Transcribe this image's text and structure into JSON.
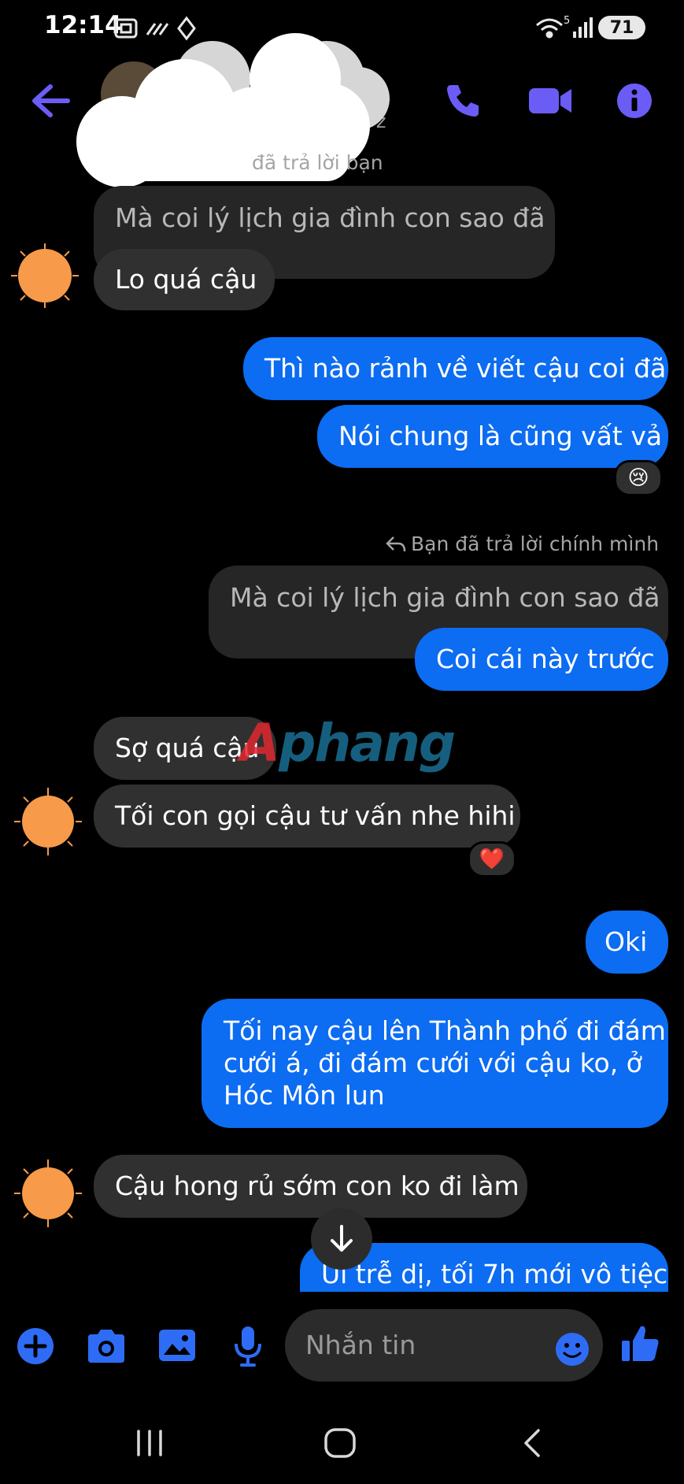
{
  "status_bar": {
    "time": "12:14",
    "wifi_superscript": "5",
    "battery": "71"
  },
  "header": {
    "subtitle_fragment": "n z",
    "icons": [
      "back-arrow-icon",
      "phone-icon",
      "video-call-icon",
      "info-icon"
    ]
  },
  "messages": {
    "reply_note_1": "đã trả lời bạn",
    "quoted_1": "Mà coi lý lịch gia đình con sao đã",
    "in_1": "Lo quá cậu",
    "out_1": "Thì nào rảnh về viết cậu coi đã",
    "out_2": "Nói chung là cũng vất vả",
    "reaction_1": "😢",
    "reply_note_2": "Bạn đã trả lời chính mình",
    "quoted_2": "Mà coi lý lịch gia đình con sao đã",
    "out_3": "Coi cái này trước",
    "in_2": "Sợ quá cậu",
    "in_3": "Tối con gọi cậu tư vấn nhe hihi",
    "reaction_2": "❤️",
    "out_4": "Oki",
    "out_5_line1": "Tối nay cậu lên Thành phố đi đám",
    "out_5_line2": "cưới á, đi đám cưới với cậu ko, ở",
    "out_5_line3": "Hóc Môn lun",
    "in_4": "Cậu hong rủ sớm con ko đi làm",
    "out_6": "Ui trễ dị, tối 7h mới vô tiệc"
  },
  "watermark": {
    "part1": "A",
    "part2": "phang"
  },
  "composer": {
    "placeholder": "Nhắn tin"
  },
  "colors": {
    "accent": "#6b5cf6",
    "outgoing_bubble": "#0c6cf2",
    "incoming_bubble": "#303030",
    "composer_icons": "#2f6cf5",
    "avatar_sun": "#f79a4a"
  }
}
